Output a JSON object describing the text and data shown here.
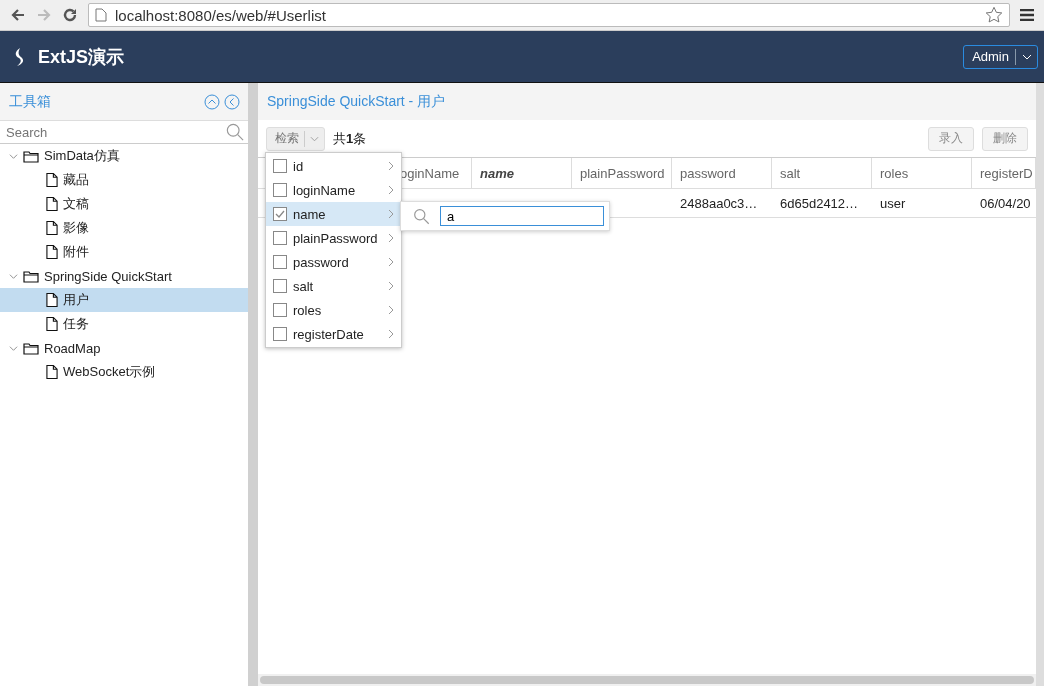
{
  "browser": {
    "url": "localhost:8080/es/web/#Userlist"
  },
  "header": {
    "title": "ExtJS演示",
    "user_button": "Admin"
  },
  "sidebar": {
    "title": "工具箱",
    "search": {
      "placeholder": "Search"
    },
    "tree": [
      {
        "label": "SimData仿真",
        "expanded": true,
        "selected": false,
        "children": [
          {
            "label": "藏品",
            "selected": false
          },
          {
            "label": "文稿",
            "selected": false
          },
          {
            "label": "影像",
            "selected": false
          },
          {
            "label": "附件",
            "selected": false
          }
        ]
      },
      {
        "label": "SpringSide QuickStart",
        "expanded": true,
        "selected": false,
        "children": [
          {
            "label": "用户",
            "selected": true
          },
          {
            "label": "任务",
            "selected": false
          }
        ]
      },
      {
        "label": "RoadMap",
        "expanded": true,
        "selected": false,
        "children": [
          {
            "label": "WebSocket示例",
            "selected": false
          }
        ]
      }
    ]
  },
  "panel": {
    "title": "SpringSide QuickStart - 用户"
  },
  "toolbar": {
    "search_button": "检索",
    "count": "共**1**条",
    "buttons": [
      "录入",
      "删除"
    ]
  },
  "table": {
    "columns": [
      {
        "label": "oginName",
        "filtered": false
      },
      {
        "label": "name",
        "filtered": true
      },
      {
        "label": "plainPassword",
        "filtered": false
      },
      {
        "label": "password",
        "filtered": false
      },
      {
        "label": "salt",
        "filtered": false
      },
      {
        "label": "roles",
        "filtered": false
      },
      {
        "label": "registerD",
        "filtered": false
      }
    ],
    "rows": [
      [
        "",
        "",
        "",
        "2488aa0c3…",
        "6d65d2412…",
        "user",
        "06/04/20"
      ]
    ]
  },
  "column_menu": {
    "items": [
      {
        "label": "id",
        "checked": false,
        "selected": false
      },
      {
        "label": "loginName",
        "checked": false,
        "selected": false
      },
      {
        "label": "name",
        "checked": true,
        "selected": true
      },
      {
        "label": "plainPassword",
        "checked": false,
        "selected": false
      },
      {
        "label": "password",
        "checked": false,
        "selected": false
      },
      {
        "label": "salt",
        "checked": false,
        "selected": false
      },
      {
        "label": "roles",
        "checked": false,
        "selected": false
      },
      {
        "label": "registerDate",
        "checked": false,
        "selected": false
      }
    ],
    "filter": {
      "value": "a"
    }
  }
}
